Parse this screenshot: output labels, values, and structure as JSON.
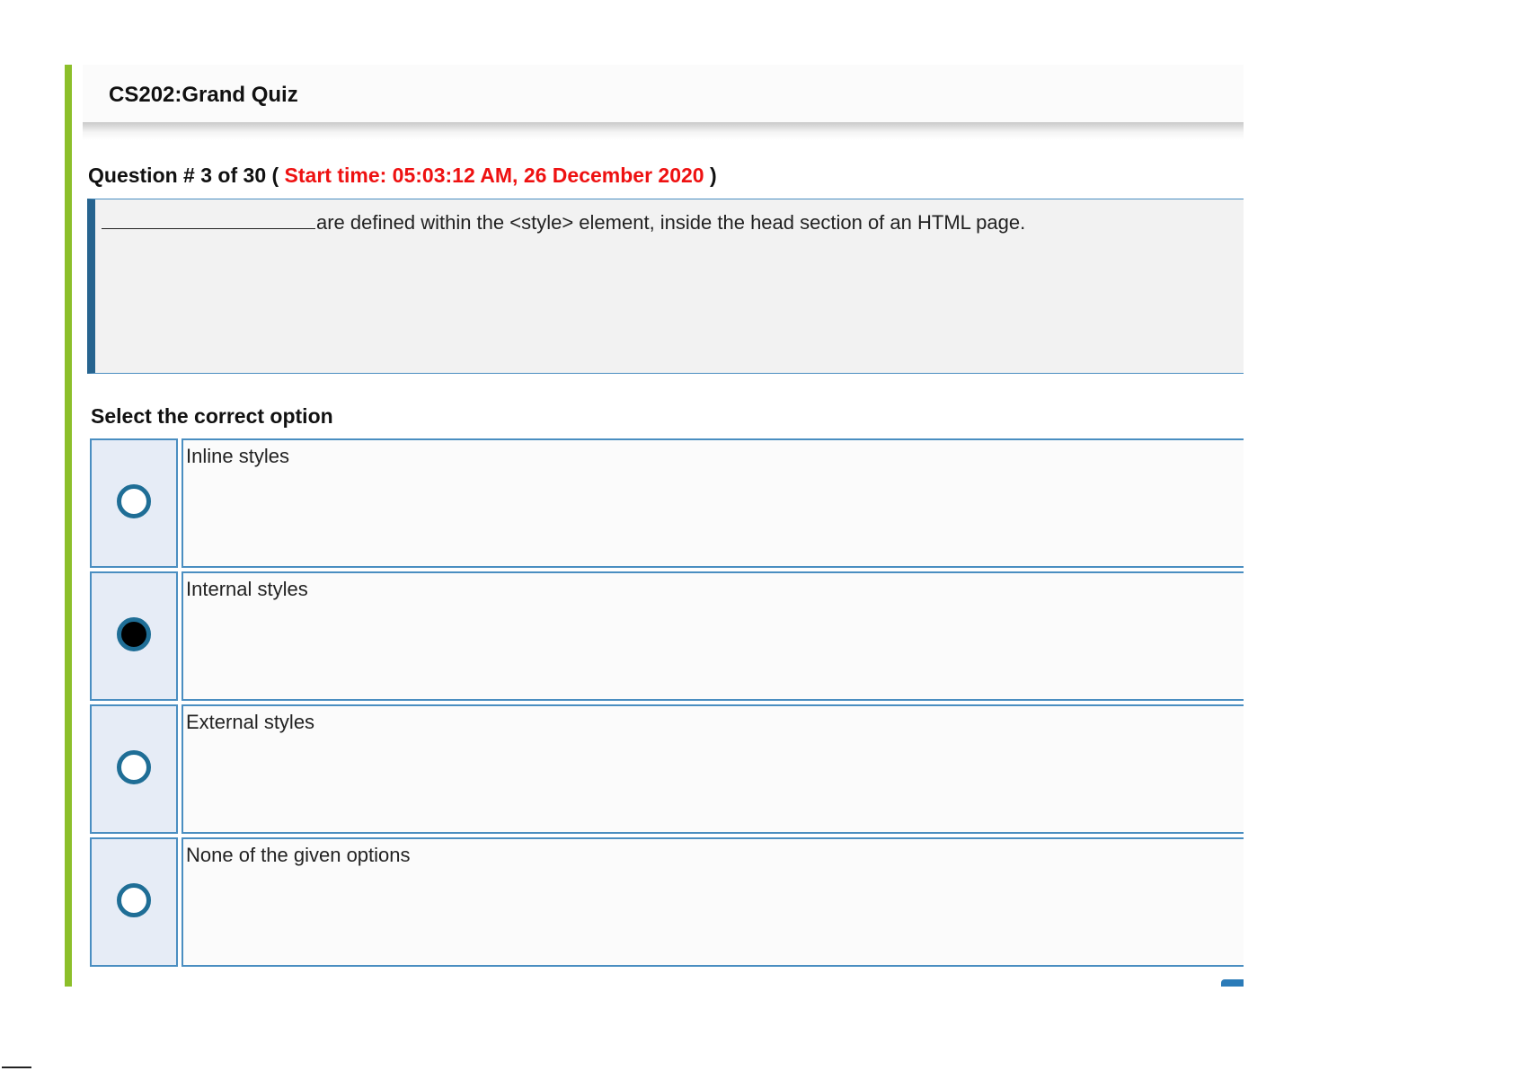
{
  "quiz": {
    "title": "CS202:Grand Quiz"
  },
  "question": {
    "prefix": "Question # 3 of 30 (",
    "start_time": "Start time: 05:03:12 AM, 26 December 2020",
    "suffix": ")",
    "text": "are defined within the <style> element, inside the head section of an HTML page."
  },
  "options": {
    "label": "Select the correct option",
    "selected_index": 1,
    "items": [
      {
        "label": "Inline styles",
        "selected": false
      },
      {
        "label": "Internal styles",
        "selected": true
      },
      {
        "label": "External styles",
        "selected": false
      },
      {
        "label": "None of the given options",
        "selected": false
      }
    ]
  },
  "colors": {
    "accent_bar": "#8cbf2a",
    "border": "#4a8ec1",
    "question_left_border": "#27648f",
    "start_time": "#ee1111",
    "radio": "#1f6e96"
  }
}
